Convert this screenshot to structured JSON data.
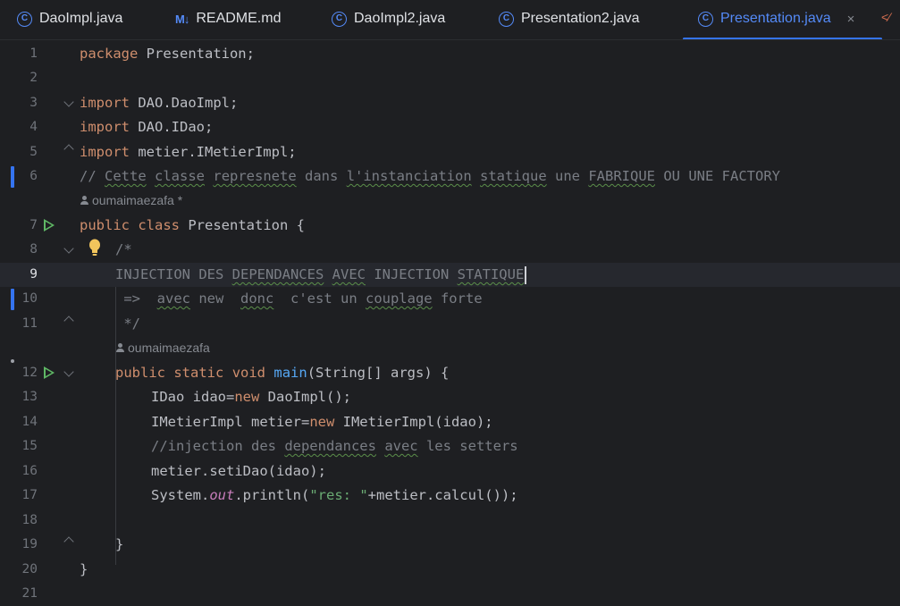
{
  "tabs": [
    {
      "label": "DaoImpl.java",
      "icon": "c-icon"
    },
    {
      "label": "README.md",
      "icon": "md-icon"
    },
    {
      "label": "DaoImpl2.java",
      "icon": "c-icon"
    },
    {
      "label": "Presentation2.java",
      "icon": "c-icon"
    },
    {
      "label": "Presentation.java",
      "icon": "c-icon",
      "active": true
    }
  ],
  "icons": {
    "class": "C",
    "markdown": "M↓",
    "close": "×",
    "overflow": "<⁄",
    "bulb": "lightbulb-icon",
    "run": "run-icon",
    "author": "user-icon"
  },
  "colors": {
    "accent": "#3574f0",
    "keyword": "#cf8e6d",
    "function": "#56a8f5",
    "string": "#6aab73",
    "comment": "#7a7e85",
    "static": "#c77dbb",
    "run": "#5fb865"
  },
  "editor": {
    "current_line": 9,
    "hints": {
      "class_author": "oumaimaezafa *",
      "method_author": "oumaimaezafa"
    },
    "lines": [
      {
        "n": "1",
        "t": {
          "kw": "package",
          "rest": " Presentation;"
        }
      },
      {
        "n": "2"
      },
      {
        "n": "3",
        "t": {
          "kw": "import",
          "rest": " DAO.DaoImpl;"
        }
      },
      {
        "n": "4",
        "t": {
          "kw": "import",
          "rest": " DAO.IDao;"
        }
      },
      {
        "n": "5",
        "t": {
          "kw": "import",
          "rest": " metier.IMetierImpl;"
        }
      },
      {
        "n": "6",
        "t": {
          "a": "// ",
          "w1": "Cette",
          "b": " ",
          "w2": "classe",
          "c": " ",
          "w3": "represnete",
          "d": " dans ",
          "w4": "l'instanciation",
          "e": " ",
          "w5": "statique",
          "f": " une ",
          "w6": "FABRIQUE",
          "g": " OU UNE FACTORY"
        }
      },
      {
        "n": "7",
        "t": {
          "kw1": "public",
          "sp": " ",
          "kw2": "class",
          "rest": " Presentation {"
        }
      },
      {
        "n": "8",
        "t": {
          "a": "/*"
        }
      },
      {
        "n": "9",
        "t": {
          "a": "INJECTION DES ",
          "w1": "DEPENDANCES",
          "b": " ",
          "w2": "AVEC",
          "c": " INJECTION ",
          "w3": "STATIQUE"
        }
      },
      {
        "n": "10",
        "t": {
          "a": " =>  ",
          "w1": "avec",
          "b": " new  ",
          "w2": "donc",
          "c": "  c'est un ",
          "w3": "couplage",
          "d": " forte"
        }
      },
      {
        "n": "11",
        "t": {
          "a": " */"
        }
      },
      {
        "n": "12",
        "t": {
          "kw1": "public",
          "sp1": " ",
          "kw2": "static",
          "sp2": " ",
          "kw3": "void",
          "sp3": " ",
          "fn": "main",
          "rest": "(String[] args) {"
        }
      },
      {
        "n": "13",
        "t": {
          "a": "IDao idao=",
          "kw": "new",
          "b": " DaoImpl();"
        }
      },
      {
        "n": "14",
        "t": {
          "a": "IMetierImpl metier=",
          "kw": "new",
          "b": " IMetierImpl(idao);"
        }
      },
      {
        "n": "15",
        "t": {
          "a": "//injection des ",
          "w1": "dependances",
          "b": " ",
          "w2": "avec",
          "c": " les setters"
        }
      },
      {
        "n": "16",
        "t": {
          "a": "metier.setiDao(idao);"
        }
      },
      {
        "n": "17",
        "t": {
          "a": "System.",
          "st": "out",
          "b": ".println(",
          "str": "\"res: \"",
          "c": "+metier.calcul());"
        }
      },
      {
        "n": "18"
      },
      {
        "n": "19",
        "t": {
          "a": "}"
        }
      },
      {
        "n": "20",
        "t": {
          "a": "}"
        }
      },
      {
        "n": "21"
      }
    ]
  }
}
